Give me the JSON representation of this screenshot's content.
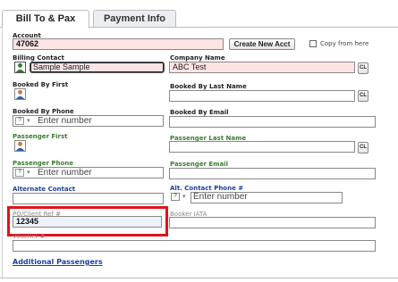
{
  "tabs": [
    {
      "label": "Bill To & Pax",
      "active": true
    },
    {
      "label": "Payment Info",
      "active": false
    }
  ],
  "account": {
    "label": "Account",
    "value": "47062",
    "create_button": "Create New Acct",
    "copy_label": "Copy from here"
  },
  "billing_contact": {
    "label": "Billing Contact",
    "value": "Sample Sample"
  },
  "company_name": {
    "label": "Company Name",
    "value": "ABC Test",
    "clear": "CL"
  },
  "booked_by_first": {
    "label": "Booked By First",
    "value": ""
  },
  "booked_by_last": {
    "label": "Booked By Last Name",
    "value": "",
    "clear": "CL"
  },
  "booked_by_phone": {
    "label": "Booked By Phone",
    "country": "?",
    "placeholder": "Enter number"
  },
  "booked_by_email": {
    "label": "Booked By Email",
    "value": ""
  },
  "passenger_first": {
    "label": "Passenger First",
    "value": ""
  },
  "passenger_last": {
    "label": "Passenger Last Name",
    "value": "",
    "clear": "CL"
  },
  "passenger_phone": {
    "label": "Passenger Phone",
    "country": "?",
    "placeholder": "Enter number"
  },
  "passenger_email": {
    "label": "Passenger Email",
    "value": ""
  },
  "alternate_contact": {
    "label": "Alternate Contact",
    "value": ""
  },
  "alt_contact_phone": {
    "label": "Alt. Contact Phone #",
    "country": "?",
    "placeholder": "Enter number"
  },
  "po_client_ref": {
    "label": "PO/Client Ref #",
    "value": "12345"
  },
  "booker_iata": {
    "label": "Booker IATA",
    "value": ""
  },
  "voucher": {
    "label": "Voucher #",
    "value": ""
  },
  "additional_passengers": "Additional Passengers",
  "colors": {
    "required_bg": "#fde3e3",
    "highlight": "#e0121b",
    "green_label": "#3a7d2c",
    "blue_label": "#1f3f9c"
  }
}
